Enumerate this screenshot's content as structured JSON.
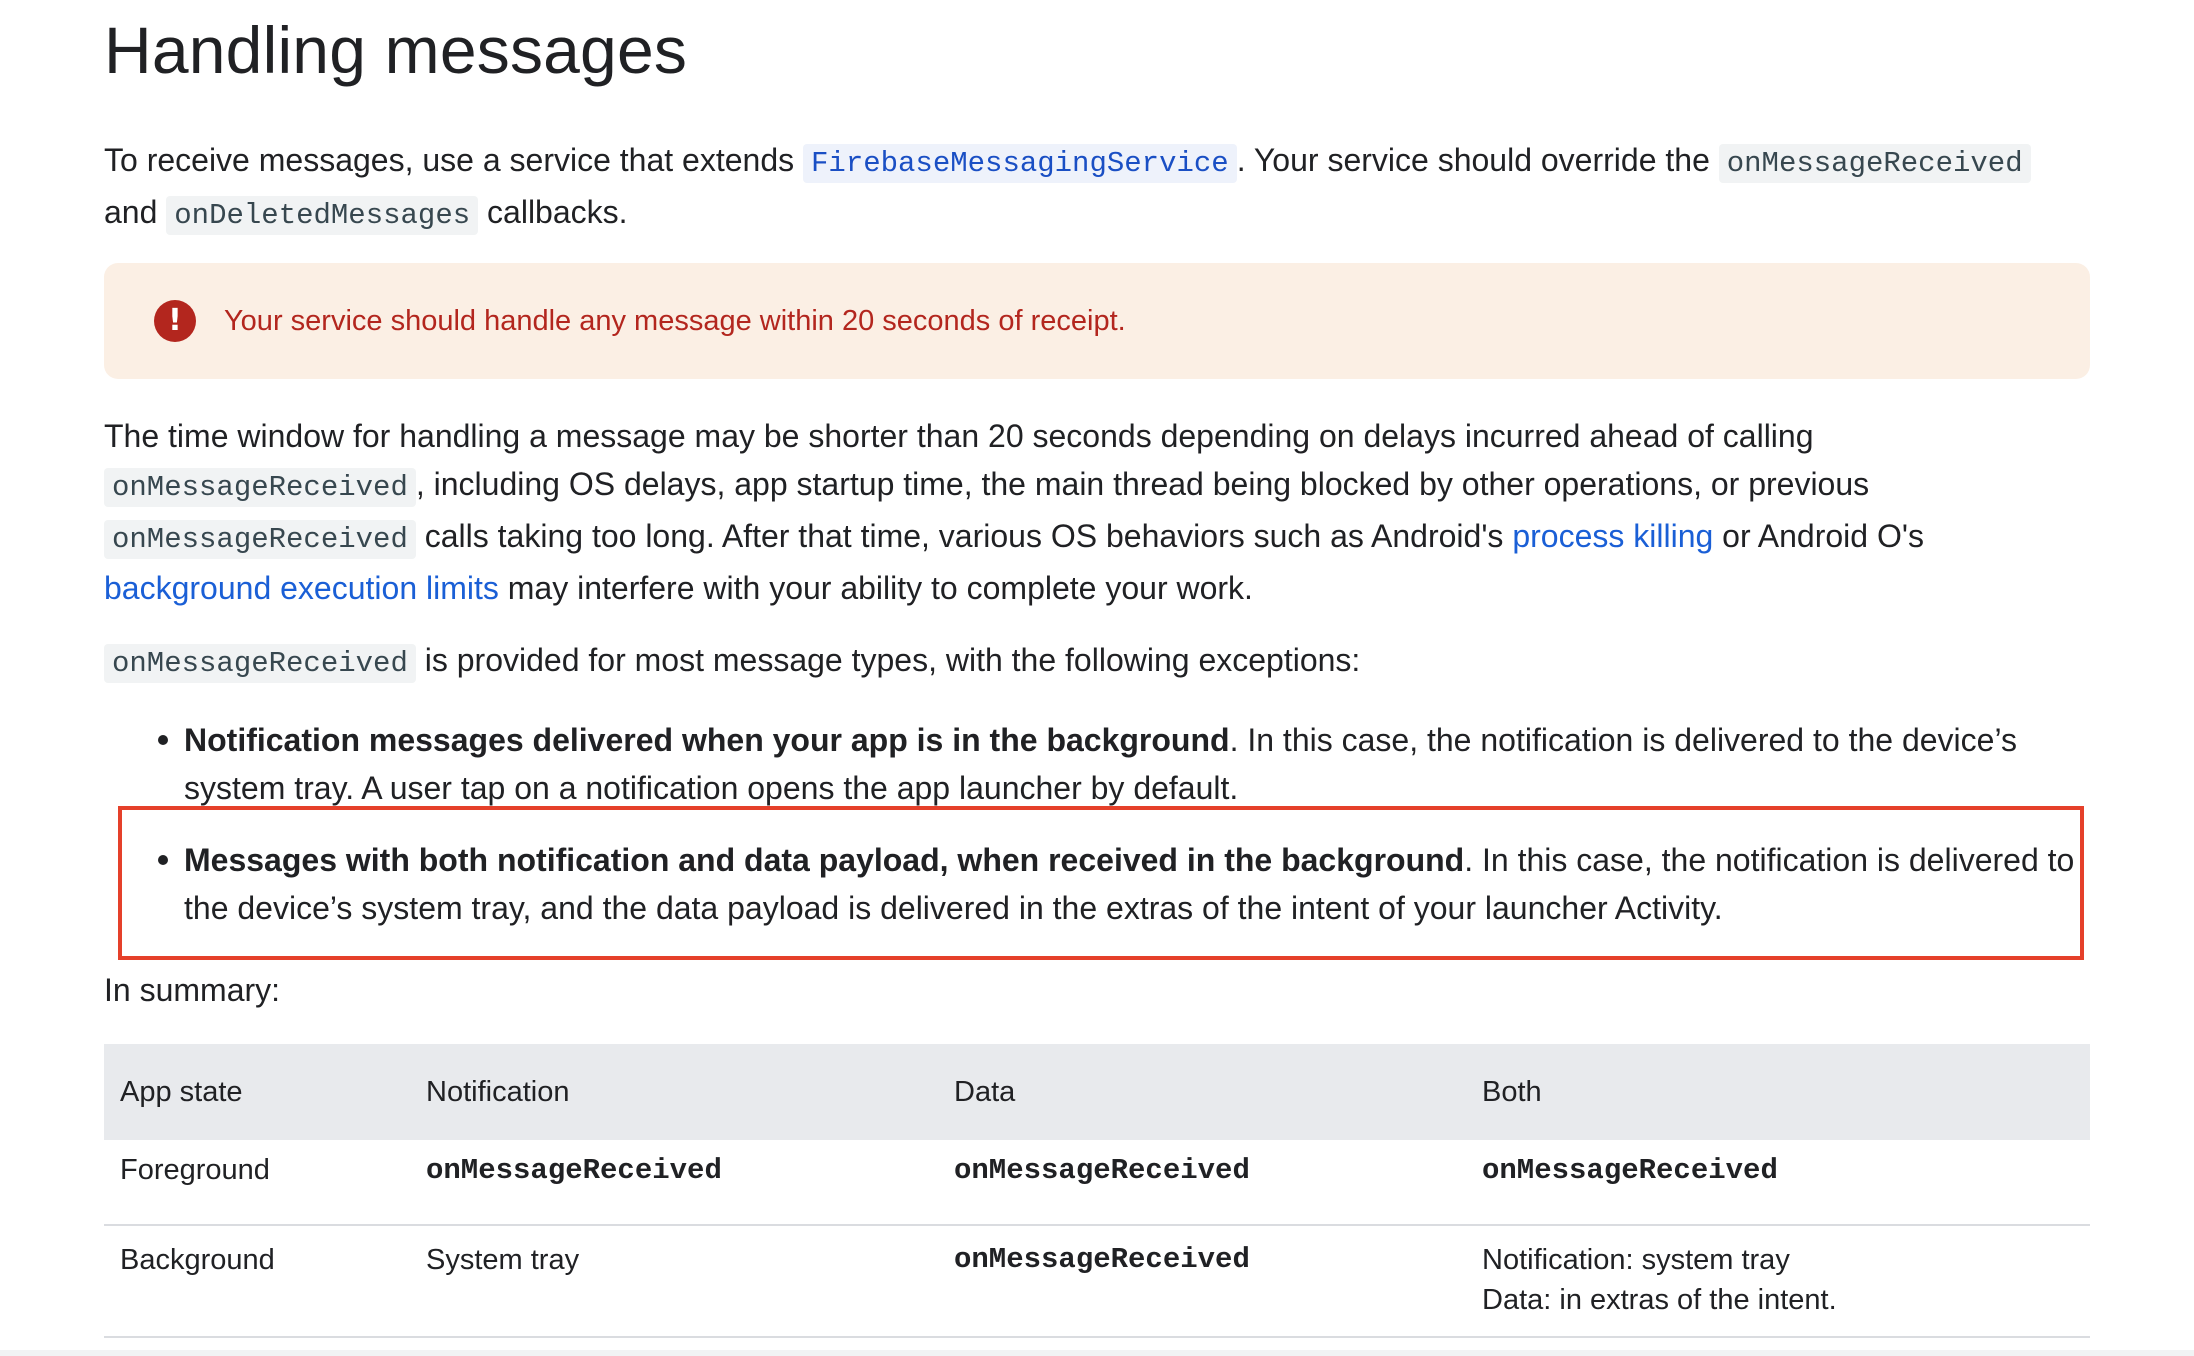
{
  "page": {
    "title": "Handling messages"
  },
  "intro": {
    "t1": "To receive messages, use a service that extends ",
    "code1": "FirebaseMessagingService",
    "t2": ". Your service should override the ",
    "code2": "onMessageReceived",
    "t3": " and ",
    "code3": "onDeletedMessages",
    "t4": " callbacks."
  },
  "callout": {
    "icon": "error-icon",
    "text": "Your service should handle any message within 20 seconds of receipt.",
    "color": "#b3261e",
    "background": "#fbefe4"
  },
  "time_window": {
    "t1": "The time window for handling a message may be shorter than 20 seconds depending on delays incurred ahead of calling ",
    "code1": "onMessageReceived",
    "t2": ", including OS delays, app startup time, the main thread being blocked by other operations, or previous ",
    "code2": "onMessageReceived",
    "t3": " calls taking too long. After that time, various OS behaviors such as Android's ",
    "link1": "process killing",
    "t4": " or Android O's ",
    "link2": "background execution limits",
    "t5": " may interfere with your ability to complete your work."
  },
  "provided": {
    "code": "onMessageReceived",
    "text": " is provided for most message types, with the following exceptions:"
  },
  "exceptions": [
    {
      "bold": "Notification messages delivered when your app is in the background",
      "text": ". In this case, the notification is delivered to the device’s system tray. A user tap on a notification opens the app launcher by default."
    },
    {
      "bold": "Messages with both notification and data payload, when received in the background",
      "text": ". In this case, the notification is delivered to the device’s system tray, and the data payload is delivered in the extras of the intent of your launcher Activity."
    }
  ],
  "highlight_color": "#e5402a",
  "summary": {
    "label": "In summary:"
  },
  "table": {
    "headers": [
      "App state",
      "Notification",
      "Data",
      "Both"
    ],
    "rows": [
      [
        "Foreground",
        "onMessageReceived",
        "onMessageReceived",
        "onMessageReceived"
      ],
      [
        "Background",
        "System tray",
        "onMessageReceived",
        "Notification: system tray",
        "Data: in extras of the intent."
      ]
    ]
  }
}
